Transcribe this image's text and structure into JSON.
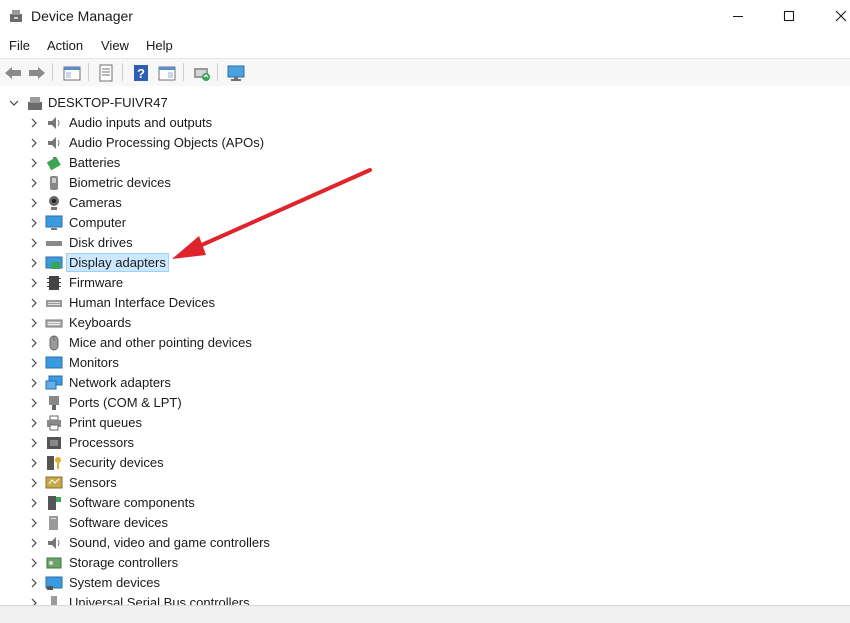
{
  "window": {
    "title": "Device Manager"
  },
  "menu": {
    "items": [
      "File",
      "Action",
      "View",
      "Help"
    ]
  },
  "tree": {
    "root": "DESKTOP-FUIVR47",
    "items": [
      "Audio inputs and outputs",
      "Audio Processing Objects (APOs)",
      "Batteries",
      "Biometric devices",
      "Cameras",
      "Computer",
      "Disk drives",
      "Display adapters",
      "Firmware",
      "Human Interface Devices",
      "Keyboards",
      "Mice and other pointing devices",
      "Monitors",
      "Network adapters",
      "Ports (COM & LPT)",
      "Print queues",
      "Processors",
      "Security devices",
      "Sensors",
      "Software components",
      "Software devices",
      "Sound, video and game controllers",
      "Storage controllers",
      "System devices",
      "Universal Serial Bus controllers"
    ],
    "selected": "Display adapters"
  },
  "colors": {
    "selection": "#cce8ff",
    "selection_border": "#99d1ff",
    "annotation_arrow": "#e0242b"
  },
  "icons": {
    "toolbar": [
      "back-arrow-icon",
      "forward-arrow-icon",
      "show-hide-console-tree-icon",
      "properties-icon",
      "help-icon",
      "action-pane-icon",
      "update-driver-icon",
      "scan-hardware-icon"
    ]
  }
}
